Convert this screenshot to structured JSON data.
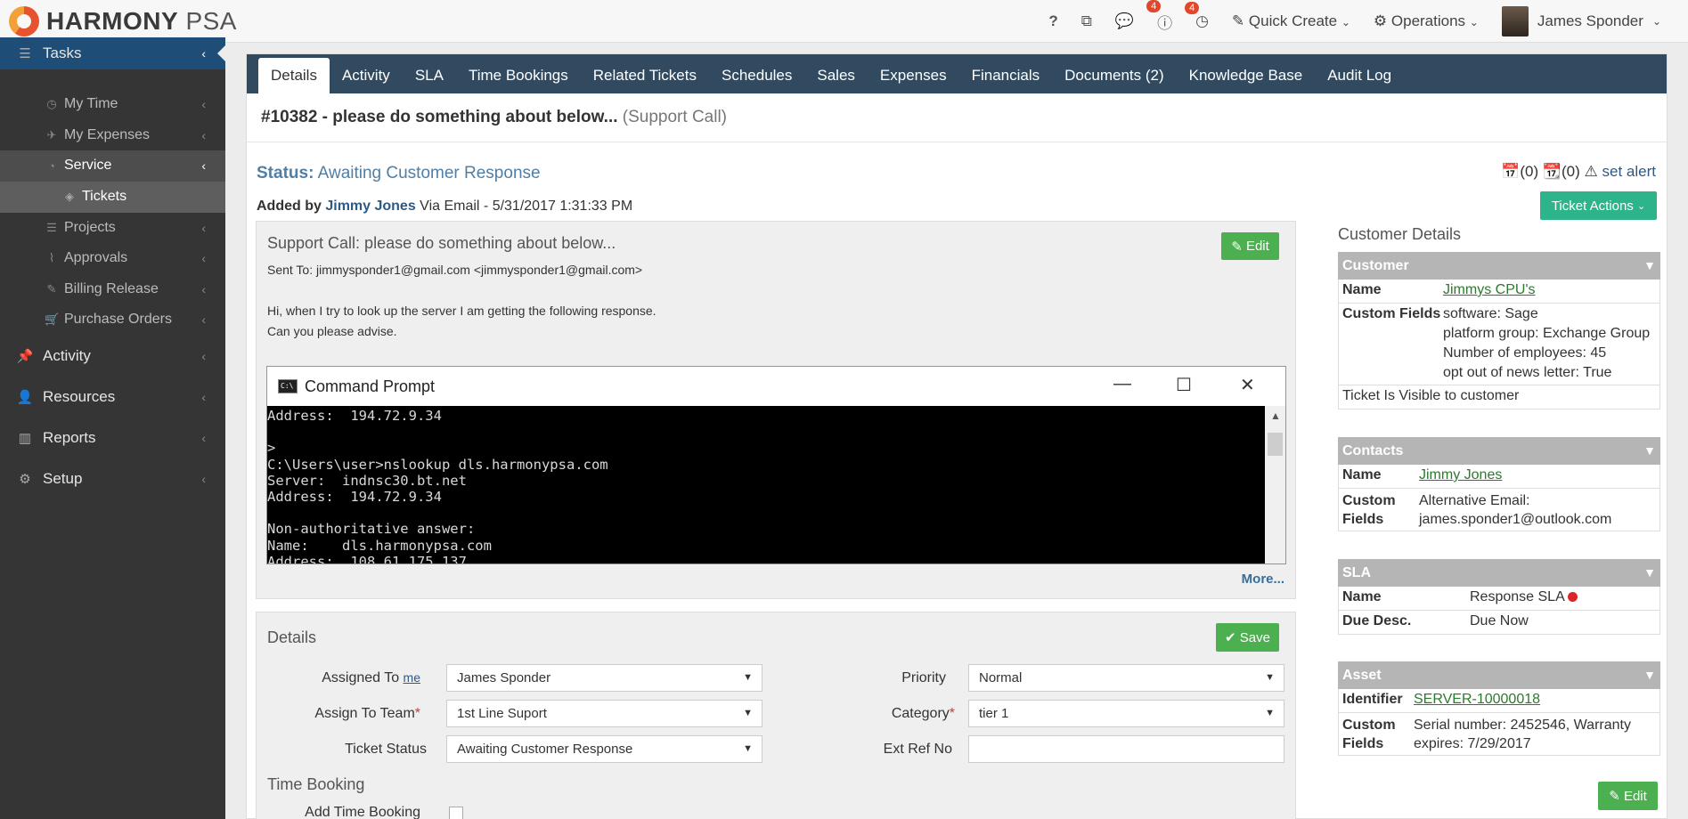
{
  "app": {
    "brand_main": "HARMONY",
    "brand_sub": " PSA"
  },
  "topbar": {
    "help": "?",
    "notif_badge_1": "4",
    "notif_badge_2": "4",
    "quick_create": "Quick Create",
    "operations": "Operations",
    "user_name": "James Sponder"
  },
  "sidebar": {
    "tasks": "Tasks",
    "my_time": "My Time",
    "my_expenses": "My Expenses",
    "service": "Service",
    "tickets": "Tickets",
    "projects": "Projects",
    "approvals": "Approvals",
    "billing_release": "Billing Release",
    "purchase_orders": "Purchase Orders",
    "activity": "Activity",
    "resources": "Resources",
    "reports": "Reports",
    "setup": "Setup"
  },
  "tabs": [
    "Details",
    "Activity",
    "SLA",
    "Time Bookings",
    "Related Tickets",
    "Schedules",
    "Sales",
    "Expenses",
    "Financials",
    "Documents (2)",
    "Knowledge Base",
    "Audit Log"
  ],
  "ticket": {
    "title": "#10382 - please do something about below...",
    "type": " (Support Call)",
    "status_label": "Status:",
    "status_value": " Awaiting Customer Response",
    "added_by_label": "Added by ",
    "added_by_name": "Jimmy Jones",
    "added_via": " Via Email - 5/31/2017 1:31:33 PM",
    "alerts_count_1": "(0)",
    "alerts_count_2": "(0)",
    "set_alert": "set alert",
    "ticket_actions": "Ticket Actions"
  },
  "email": {
    "subject": "Support Call: please do something about below...",
    "sent_to": "Sent To: jimmysponder1@gmail.com <jimmysponder1@gmail.com>",
    "body_line1": "Hi, when I try to look up the server I am getting the following response.",
    "body_line2": "Can you please advise.",
    "edit": "Edit",
    "more": "More..."
  },
  "cmd": {
    "title": "Command Prompt",
    "lines": [
      "Address:  194.72.9.34",
      "",
      ">",
      "C:\\Users\\user>nslookup dls.harmonypsa.com",
      "Server:  indnsc30.bt.net",
      "Address:  194.72.9.34",
      "",
      "Non-authoritative answer:",
      "Name:    dls.harmonypsa.com",
      "Address:  108.61.175.137"
    ]
  },
  "details": {
    "heading": "Details",
    "save": "Save",
    "assigned_to_label": "Assigned To ",
    "assigned_to_me": "me",
    "assigned_to_value": "James Sponder",
    "assign_team_label": "Assign To Team",
    "assign_team_value": "1st Line Suport",
    "ticket_status_label": "Ticket Status",
    "ticket_status_value": "Awaiting Customer Response",
    "priority_label": "Priority",
    "priority_value": "Normal",
    "category_label": "Category",
    "category_value": "tier 1",
    "ext_ref_label": "Ext Ref No",
    "ext_ref_value": "",
    "required_mark": "*",
    "time_booking_heading": "Time Booking",
    "add_time_booking": "Add Time Booking"
  },
  "customer_details": {
    "heading": "Customer Details",
    "customer": {
      "header": "Customer",
      "name_label": "Name",
      "name_value": "Jimmys CPU's",
      "custom_fields_label": "Custom Fields",
      "cf1": "software: Sage",
      "cf2": "platform group: Exchange Group",
      "cf3": "Number of employees: 45",
      "cf4": "opt out of news letter: True",
      "visible": "Ticket Is Visible to customer"
    },
    "contacts": {
      "header": "Contacts",
      "name_label": "Name",
      "name_value": "Jimmy Jones",
      "cf_label_1": "Custom",
      "cf_label_2": "Fields",
      "cf1": "Alternative Email:",
      "cf2": "james.sponder1@outlook.com"
    },
    "sla": {
      "header": "SLA",
      "name_label": "Name",
      "name_value": "Response SLA",
      "due_label": "Due Desc.",
      "due_value": "Due Now"
    },
    "asset": {
      "header": "Asset",
      "id_label": "Identifier",
      "id_value": "SERVER-10000018",
      "cf_label_1": "Custom",
      "cf_label_2": "Fields",
      "cf1": "Serial number: 2452546, Warranty",
      "cf2": "expires: 7/29/2017"
    },
    "edit": "Edit"
  },
  "colors": {
    "tab_bar": "#324a5f",
    "accent_green": "#4caf50",
    "teal": "#2eb48a",
    "sidebar": "#353535",
    "link_blue": "#2c5a85"
  }
}
